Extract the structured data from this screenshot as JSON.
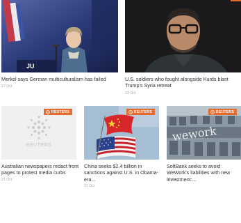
{
  "articles": [
    {
      "title": "Merkel says German multiculturalism has failed",
      "date": "17 Oct"
    },
    {
      "title": "U.S. soldiers who fought alongside Kurds blast Trump's Syria retreat",
      "date": "23 Oct"
    },
    {
      "title": "Australian newspapers redact front pages to protest media curbs",
      "date": "21 Oct",
      "badge": "REUTERS"
    },
    {
      "title": "China seeks $2.4 billion in sanctions against U.S. in Obama-era...",
      "date": "21 Oct",
      "badge": "REUTERS"
    },
    {
      "title": "SoftBank seeks to avoid WeWork's liabilities with new investment:...",
      "date": "18 Oct",
      "badge": "REUTERS"
    }
  ],
  "placeholder": {
    "wordmark": "REUTERS"
  },
  "photo_text": {
    "podium": "JU",
    "wework": "wework"
  },
  "colors": {
    "badge": "#e46a2e",
    "date": "#a3a3a3"
  }
}
